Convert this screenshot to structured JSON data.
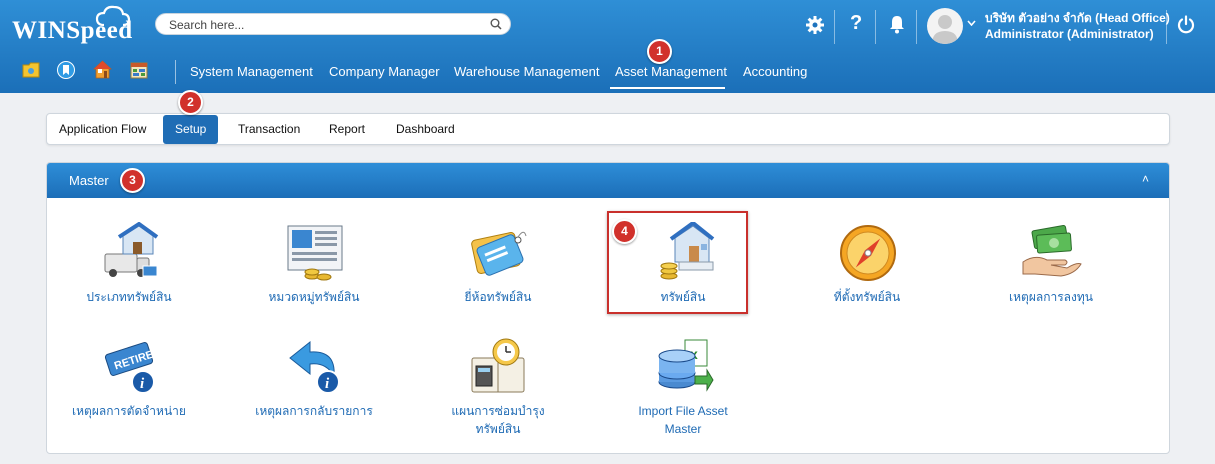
{
  "header": {
    "logo": "WINSpeed",
    "search_placeholder": "Search here...",
    "company_line1": "บริษัท ตัวอย่าง จำกัด (Head Office)",
    "company_line2": "Administrator (Administrator)"
  },
  "menu": {
    "items": [
      "System Management",
      "Company Manager",
      "Warehouse Management",
      "Asset Management",
      "Accounting"
    ],
    "active": "Asset Management"
  },
  "subtabs": {
    "items": [
      "Application Flow",
      "Setup",
      "Transaction",
      "Report",
      "Dashboard"
    ],
    "active": "Setup"
  },
  "panel": {
    "title": "Master",
    "collapse_glyph": "˄"
  },
  "tiles": [
    {
      "label": "ประเภททรัพย์สิน",
      "icon": "asset-type-icon"
    },
    {
      "label": "หมวดหมู่ทรัพย์สิน",
      "icon": "asset-category-icon"
    },
    {
      "label": "ยี่ห้อทรัพย์สิน",
      "icon": "asset-brand-tag-icon"
    },
    {
      "label": "ทรัพย์สิน",
      "icon": "asset-building-coins-icon"
    },
    {
      "label": "ที่ตั้งทรัพย์สิน",
      "icon": "compass-icon"
    },
    {
      "label": "เหตุผลการลงทุน",
      "icon": "money-hand-icon"
    },
    {
      "label": "เหตุผลการตัดจำหน่าย",
      "icon": "retire-sign-icon"
    },
    {
      "label": "เหตุผลการกลับรายการ",
      "icon": "reverse-arrow-icon"
    },
    {
      "label_line1": "แผนการซ่อมบำรุง",
      "label_line2": "ทรัพย์สิน",
      "icon": "maintenance-plan-icon"
    },
    {
      "label_line1": "Import File Asset",
      "label_line2": "Master",
      "icon": "excel-database-icon"
    }
  ],
  "badges": [
    "1",
    "2",
    "3",
    "4"
  ],
  "colors": {
    "header_blue": "#1b6fb8",
    "link_blue": "#1e6ab4",
    "badge_red": "#d1312b",
    "highlight_red": "#c9302c"
  }
}
